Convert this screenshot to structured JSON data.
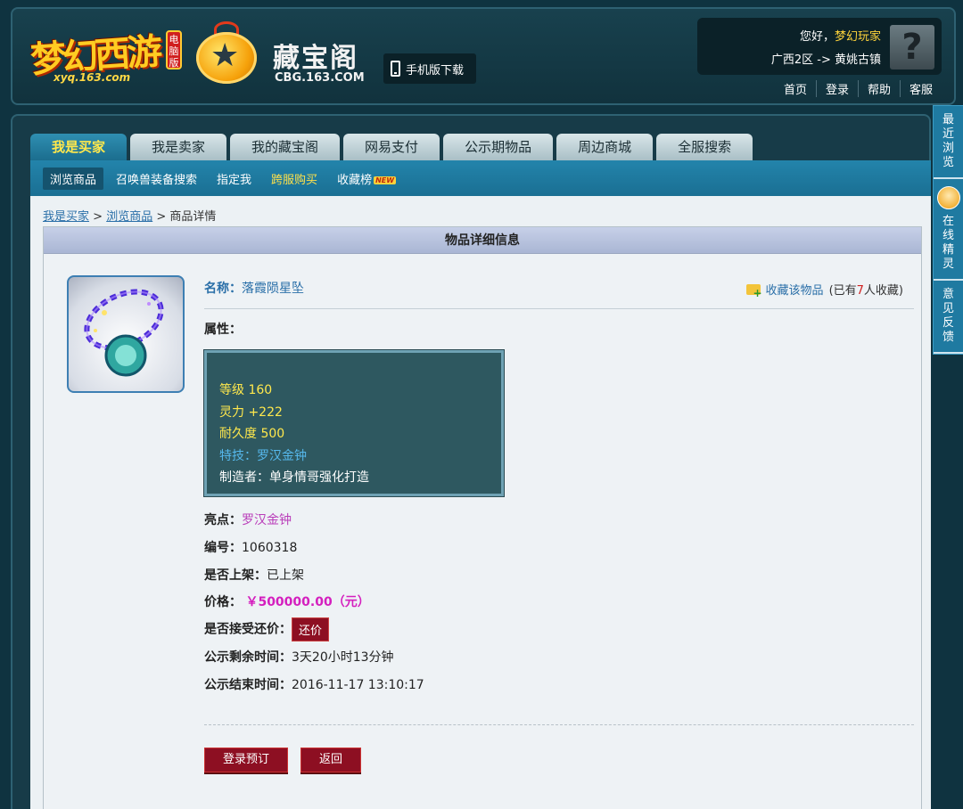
{
  "header": {
    "game_logo": "梦幻西游",
    "game_logo_tag": "电脑版",
    "game_url": "xyq.163.com",
    "cbg_name": "藏宝阁",
    "cbg_url": "CBG.163.COM",
    "mobile_download": "手机版下载",
    "greeting_prefix": "您好，",
    "username": "梦幻玩家",
    "server": "广西2区 -> 黄姚古镇",
    "links": [
      "首页",
      "登录",
      "帮助",
      "客服"
    ]
  },
  "tabs": [
    "我是买家",
    "我是卖家",
    "我的藏宝阁",
    "网易支付",
    "公示期物品",
    "周边商城",
    "全服搜索"
  ],
  "active_tab_index": 0,
  "subnav": [
    "浏览商品",
    "召唤兽装备搜索",
    "指定我",
    "跨服购买",
    "收藏榜"
  ],
  "subnav_new_badge": "NEW",
  "breadcrumb": {
    "link1": "我是买家",
    "sep1": " > ",
    "link2": "浏览商品",
    "sep2": " > ",
    "current": "商品详情"
  },
  "panel_title": "物品详细信息",
  "item": {
    "name_label": "名称：",
    "name": "落霞陨星坠",
    "favorite_link": "收藏该物品",
    "favorite_prefix": "(已有",
    "favorite_count": "7",
    "favorite_suffix": "人收藏)",
    "attr_label": "属性：",
    "attributes": {
      "level": "等级 160",
      "spirit": "灵力 +222",
      "durability": "耐久度 500",
      "skill": "特技：罗汉金钟",
      "maker": "制造者：单身情哥强化打造"
    },
    "highlight_label": "亮点：",
    "highlight": "罗汉金钟",
    "id_label": "编号：",
    "id": "1060318",
    "listed_label": "是否上架：",
    "listed": "已上架",
    "price_label": "价格：",
    "price": "￥500000.00（元）",
    "bargain_label": "是否接受还价：",
    "bargain_button": "还价",
    "remaining_label": "公示剩余时间：",
    "remaining": "3天20小时13分钟",
    "end_label": "公示结束时间：",
    "end_time": "2016-11-17 13:10:17"
  },
  "actions": {
    "login_reserve": "登录预订",
    "back": "返回"
  },
  "sidebar": {
    "recent": [
      "最",
      "近",
      "浏",
      "览"
    ],
    "fairy": [
      "在",
      "线",
      "精",
      "灵"
    ],
    "feedback": [
      "意",
      "见",
      "反",
      "馈"
    ]
  },
  "colors": {
    "accent_yellow": "#ffe84c",
    "price_purple": "#d41fbe",
    "button_red": "#8d0f22",
    "link_blue": "#2a6fa8"
  }
}
